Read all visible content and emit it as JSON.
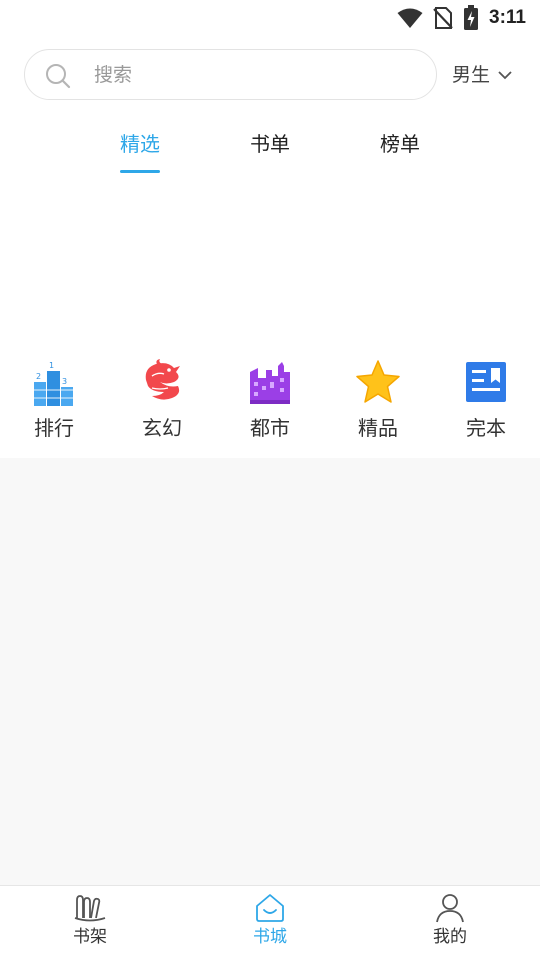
{
  "status_bar": {
    "time": "3:11",
    "icons": [
      "wifi-icon",
      "no-sim-icon",
      "battery-charging-icon"
    ]
  },
  "search": {
    "placeholder": "搜索",
    "icon": "search-icon"
  },
  "gender_selector": {
    "value": "男生",
    "icon": "chevron-down-icon"
  },
  "tabs": [
    {
      "label": "精选",
      "active": true
    },
    {
      "label": "书单",
      "active": false
    },
    {
      "label": "榜单",
      "active": false
    }
  ],
  "categories": [
    {
      "label": "排行",
      "icon": "ranking-podium-icon"
    },
    {
      "label": "玄幻",
      "icon": "dragon-icon"
    },
    {
      "label": "都市",
      "icon": "city-buildings-icon"
    },
    {
      "label": "精品",
      "icon": "star-icon"
    },
    {
      "label": "完本",
      "icon": "finished-book-icon"
    }
  ],
  "bottom_nav": [
    {
      "label": "书架",
      "icon": "bookshelf-icon",
      "active": false
    },
    {
      "label": "书城",
      "icon": "bookstore-home-icon",
      "active": true
    },
    {
      "label": "我的",
      "icon": "profile-icon",
      "active": false
    }
  ],
  "colors": {
    "accent": "#2ea7e8",
    "content_background": "#f8f8f8"
  }
}
